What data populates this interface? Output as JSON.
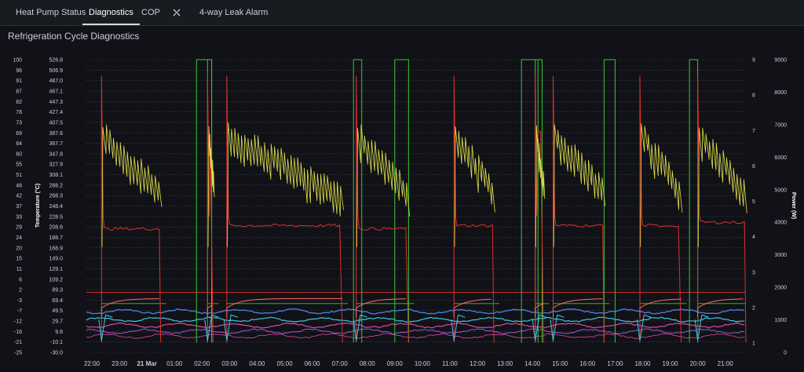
{
  "tabs": [
    {
      "label": "Heat Pump Status"
    },
    {
      "label": "Diagnostics"
    },
    {
      "label": "COP"
    },
    {
      "label": "4-way Leak Alarm"
    }
  ],
  "panel": {
    "title": "Refrigeration Cycle Diagnostics"
  },
  "colors": {
    "background": "#111217",
    "red": "#e02f2f",
    "green": "#37c837",
    "yellow": "#e0e04a",
    "cyan": "#3cc8e6",
    "blue": "#4a7be0",
    "pink": "#e048a0",
    "salmon": "#ff6a5a",
    "purple": "#9b5be0"
  },
  "chart_data": {
    "type": "line",
    "ylabel_left": "Temperature (°C)",
    "ylabel_right": "Power (W)",
    "y_left_ticks": [
      "100",
      "96",
      "91",
      "87",
      "82",
      "78",
      "73",
      "69",
      "64",
      "60",
      "55",
      "51",
      "46",
      "42",
      "37",
      "33",
      "29",
      "24",
      "20",
      "15",
      "11",
      "6",
      "2",
      "-3",
      "-7",
      "-12",
      "-16",
      "-21",
      "-25"
    ],
    "y_mid_ticks": [
      "526.8",
      "506.9",
      "487.0",
      "467.1",
      "447.3",
      "427.4",
      "407.5",
      "387.6",
      "367.7",
      "347.8",
      "327.9",
      "308.1",
      "288.2",
      "268.3",
      "248.4",
      "228.5",
      "208.6",
      "188.7",
      "168.9",
      "149.0",
      "129.1",
      "109.2",
      "89.3",
      "69.4",
      "49.5",
      "29.7",
      "9.8",
      "-10.1",
      "-30.0"
    ],
    "y_right1_ticks": [
      "9",
      "8",
      "7",
      "6",
      "5",
      "4",
      "3",
      "2",
      "1"
    ],
    "y_right2_ticks": [
      "9000",
      "8000",
      "7000",
      "6000",
      "5000",
      "4000",
      "3000",
      "2000",
      "1000",
      "0"
    ],
    "y_left_range": [
      -25,
      100
    ],
    "y_right_power_range": [
      0,
      9000
    ],
    "x_range_hours": [
      21.8,
      45.75
    ],
    "x_ticks": [
      {
        "h": 22,
        "label": "22:00",
        "bold": false
      },
      {
        "h": 23,
        "label": "23:00",
        "bold": false
      },
      {
        "h": 24,
        "label": "21 Mar",
        "bold": true
      },
      {
        "h": 25,
        "label": "01:00",
        "bold": false
      },
      {
        "h": 26,
        "label": "02:00",
        "bold": false
      },
      {
        "h": 27,
        "label": "03:00",
        "bold": false
      },
      {
        "h": 28,
        "label": "04:00",
        "bold": false
      },
      {
        "h": 29,
        "label": "05:00",
        "bold": false
      },
      {
        "h": 30,
        "label": "06:00",
        "bold": false
      },
      {
        "h": 31,
        "label": "07:00",
        "bold": false
      },
      {
        "h": 32,
        "label": "08:00",
        "bold": false
      },
      {
        "h": 33,
        "label": "09:00",
        "bold": false
      },
      {
        "h": 34,
        "label": "10:00",
        "bold": false
      },
      {
        "h": 35,
        "label": "11:00",
        "bold": false
      },
      {
        "h": 36,
        "label": "12:00",
        "bold": false
      },
      {
        "h": 37,
        "label": "13:00",
        "bold": false
      },
      {
        "h": 38,
        "label": "14:00",
        "bold": false
      },
      {
        "h": 39,
        "label": "15:00",
        "bold": false
      },
      {
        "h": 40,
        "label": "16:00",
        "bold": false
      },
      {
        "h": 41,
        "label": "17:00",
        "bold": false
      },
      {
        "h": 42,
        "label": "18:00",
        "bold": false
      },
      {
        "h": 43,
        "label": "19:00",
        "bold": false
      },
      {
        "h": 44,
        "label": "20:00",
        "bold": false
      },
      {
        "h": 45,
        "label": "21:00",
        "bold": false
      }
    ],
    "grid": true,
    "cycles": [
      {
        "start": 22.35,
        "end": 24.5,
        "green": [
          25.8,
          26.35
        ],
        "power_level": 3800
      },
      {
        "start": 26.2,
        "end": 26.4,
        "green": [
          26.2,
          26.35
        ],
        "power_level": 6500
      },
      {
        "start": 26.9,
        "end": 31.1,
        "green": [
          31.5,
          31.8
        ],
        "power_level": 3900
      },
      {
        "start": 31.6,
        "end": 33.5,
        "green": [
          33.0,
          33.5
        ],
        "power_level": 3800
      },
      {
        "start": 35.15,
        "end": 36.6,
        "green": [
          37.6,
          38.2
        ],
        "power_level": 3900
      },
      {
        "start": 38.1,
        "end": 38.4,
        "green": [
          38.1,
          38.35
        ],
        "power_level": 6800
      },
      {
        "start": 38.75,
        "end": 40.6,
        "green": [
          40.6,
          41.0
        ],
        "power_level": 3900
      },
      {
        "start": 41.9,
        "end": 43.4,
        "green": [
          43.7,
          44.0
        ],
        "power_level": 3900
      },
      {
        "start": 44.0,
        "end": 45.75,
        "green": [
          45.75,
          45.75
        ],
        "power_level": 4000
      }
    ]
  }
}
